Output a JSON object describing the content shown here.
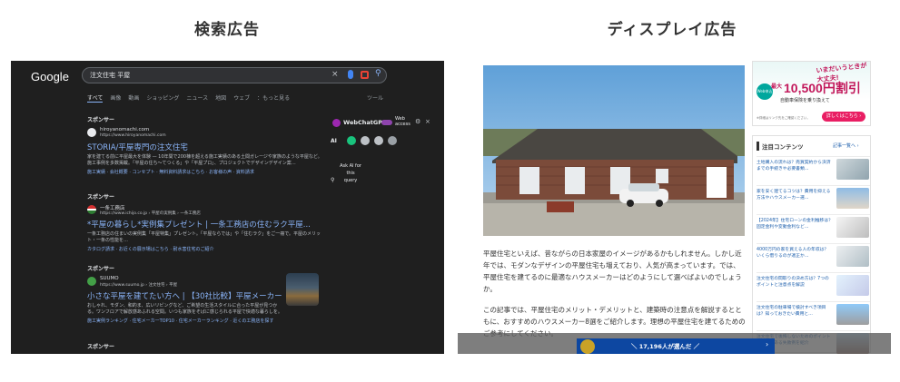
{
  "titles": {
    "search_ads": "検索広告",
    "display_ads": "ディスプレイ広告"
  },
  "google": {
    "logo": "Google",
    "query": "注文住宅 平屋",
    "tabs": [
      "すべて",
      "画像",
      "動画",
      "ショッピング",
      "ニュース",
      "地図",
      "ウェブ",
      "：もっと見る"
    ],
    "tools": "ツール",
    "ads": [
      {
        "sponsor": "スポンサー",
        "site_name": "hiroyanomachi.com",
        "site_url": "https://www.hiroyanomachi.com",
        "title": "STORIA/平屋専門の注文住宅",
        "description": "家を建てる前に平屋最大を体験 — 10年間で200棟を超える施工実績のある土間ガレージや家族のような平屋など。施工事例を多数掲載。「平屋の住ち～てつくる」や「平屋プロ」、プロジェクトでデザインデザイン案…",
        "links": "施工実績 · 会社概要 · コンセプト · 無料資料請求はこちら · お客様の声 · 資料請求"
      },
      {
        "sponsor": "スポンサー",
        "site_name": "一条工務店",
        "site_url": "https://www.ichijo.co.jp › 平屋の実例集 › 一条工務店",
        "title": "*平屋の暮らし*実例集プレゼント | 一条工務店の住むラク平屋...",
        "description": "一条工務店の住まいの実例集「平屋特集」プレゼント。「平屋ならでは」や「住むラク」をご一冊で。平屋のメリット・一条の性能を…",
        "links": "カタログ請求 · お近くの展示場はこちら · 耐水害住宅のご紹介"
      },
      {
        "sponsor": "スポンサー",
        "site_name": "SUUMO",
        "site_url": "https://www.suumo.jp › 注文住宅 › 平屋",
        "title": "小さな平屋を建てたい方へ | 【30社比較】平屋メーカー",
        "description": "おしゃれ、モダン、和的ま、広いリビングなど、ご希望の生活スタイルに合った平屋が見つかる。ワンフロアで解放感あふれる空間。いつも家族をそばに感じられる平屋で快適な暮らしを。",
        "links": "施工実例ランキング · 住宅メーカーTOP10 · 住宅メーカーランキング · 近くの工務店を探す"
      }
    ],
    "sponsor_next": "スポンサー",
    "webchat": {
      "name": "WebChatGPT",
      "toggle_label": "Web access",
      "ai_label": "AI",
      "ask": "Ask AI for this query"
    }
  },
  "display": {
    "article": [
      "平屋住宅といえば、昔ながらの日本家屋のイメージがあるかもしれません。しかし近年では、モダンなデザインの平屋住宅も増えており、人気が高まっています。では、平屋住宅を建てるのに最適なハウスメーカーはどのようにして選べばよいのでしょうか。",
      "この記事では、平屋住宅のメリット・デメリットと、建築時の注意点を解説するとともに、おすすめのハウスメーカー8選をご紹介します。理想の平屋住宅を建てるためのご参考にしてください。"
    ],
    "sidebar_ad": {
      "tagline": "いまだいうときが大丈夫!",
      "badge": "Web申込で",
      "max": "最大",
      "amount": "10,500円割引",
      "sub": "自動車保険を乗り換えて",
      "note": "※詳細はリンク先をご確認ください。",
      "button": "詳しくはこちら ›"
    },
    "sidebar": {
      "title": "注目コンテンツ",
      "more": "記事一覧へ ›",
      "items": [
        "土地購入の流れは？売買契約から決済までの手続きや必要書類…",
        "家を安く建てるコツは？費用を抑える方法やハウスメーカー選…",
        "【2024年】住宅ローンの金利推移は？固定金利や変動金利など…",
        "4000万円の家を買える人の年収は？いくら借りるのが適正か…",
        "注文住宅の間取りの決め方は？7つのポイントと注意点を解説",
        "注文住宅の駐車場で検討すべき項目は？知っておきたい費用と…",
        "注文住宅で後悔しないためのポイントは？よくある失敗例を紹介"
      ]
    },
    "banner": {
      "text": "＼ 17,196人が選んだ ／",
      "arrow": "›"
    }
  }
}
